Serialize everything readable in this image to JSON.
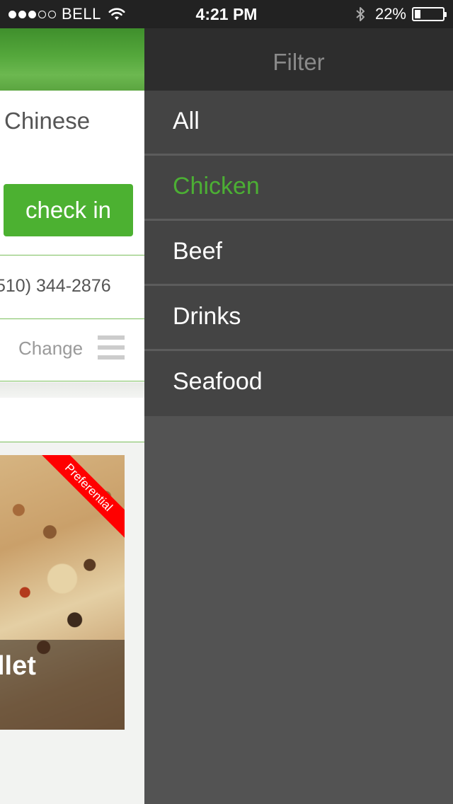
{
  "status_bar": {
    "carrier": "BELL",
    "signal_bars": 3,
    "signal_total": 5,
    "time": "4:21 PM",
    "battery_percent": "22%",
    "battery_level": 0.22
  },
  "main": {
    "category": "Chinese",
    "check_in_label": "check in",
    "phone": "510) 344-2876",
    "change_label": "Change",
    "card": {
      "badge": "Preferential",
      "title": "llet"
    }
  },
  "filter": {
    "title": "Filter",
    "items": [
      {
        "label": "All",
        "selected": false
      },
      {
        "label": "Chicken",
        "selected": true
      },
      {
        "label": "Beef",
        "selected": false
      },
      {
        "label": "Drinks",
        "selected": false
      },
      {
        "label": "Seafood",
        "selected": false
      }
    ]
  },
  "colors": {
    "accent_green": "#4caf34",
    "status_bar_bg": "#222222",
    "drawer_header_bg": "#2d2d2d",
    "drawer_item_bg": "#444444",
    "drawer_bg": "#535353",
    "ribbon_red": "#ff0000"
  }
}
